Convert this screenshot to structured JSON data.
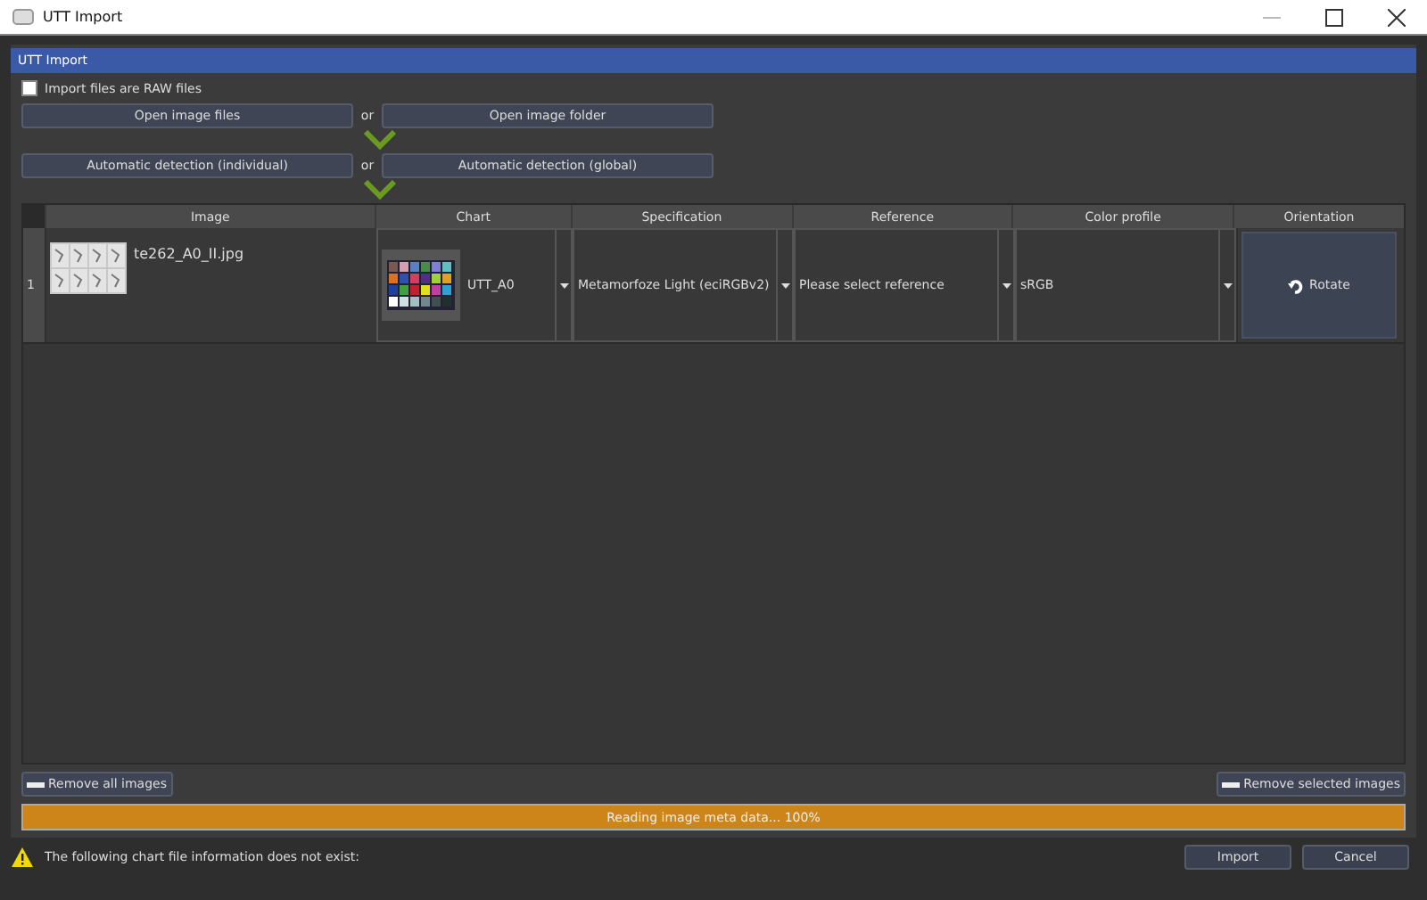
{
  "window": {
    "title": "UTT Import"
  },
  "panel": {
    "title": "UTT Import"
  },
  "raw_files": {
    "label": "Import files are RAW files",
    "checked": false
  },
  "open_buttons": {
    "left": "Open image files",
    "separator": "or",
    "right": "Open image folder"
  },
  "detect_buttons": {
    "left": "Automatic detection (individual)",
    "separator": "or",
    "right": "Automatic detection (global)"
  },
  "table": {
    "columns": [
      "Image",
      "Chart",
      "Specification",
      "Reference",
      "Color profile",
      "Orientation"
    ],
    "rows": [
      {
        "number": "1",
        "image": {
          "kind": "picture",
          "filename": "te262_A0_II.jpg"
        },
        "chart": "UTT_A0",
        "specification": "Metamorfoze Light (eciRGBv2)",
        "reference": "Please select reference",
        "color_profile": "sRGB",
        "orientation_button": "Rotate"
      }
    ]
  },
  "remove_all": "Remove all images",
  "remove_selected": "Remove selected images",
  "progress": {
    "text": "Reading image meta data... 100%",
    "level": 1
  },
  "status": {
    "message": "The following chart file information does not exist:"
  },
  "buttons": [
    "Import",
    "Cancel"
  ]
}
